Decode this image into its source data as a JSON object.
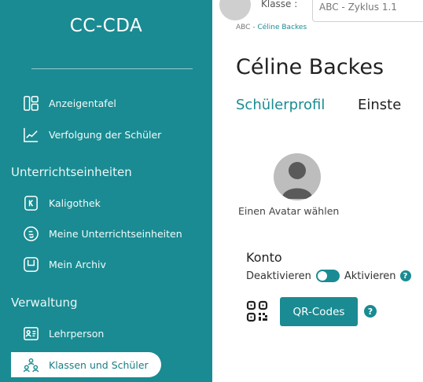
{
  "sidebar": {
    "brand": "CC-CDA",
    "items": [
      {
        "label": "Anzeigentafel",
        "icon": "dashboard-icon"
      },
      {
        "label": "Verfolgung der Schüler",
        "icon": "chart-line-icon"
      }
    ],
    "sections": [
      {
        "label": "Unterrichtseinheiten",
        "items": [
          {
            "label": "Kaligothek",
            "icon": "book-k-icon"
          },
          {
            "label": "Meine Unterrichtseinheiten",
            "icon": "face-icon"
          },
          {
            "label": "Mein Archiv",
            "icon": "archive-icon"
          }
        ]
      },
      {
        "label": "Verwaltung",
        "items": [
          {
            "label": "Lehrperson",
            "icon": "id-card-icon"
          },
          {
            "label": "Klassen und Schüler",
            "icon": "group-icon",
            "active": true
          }
        ]
      }
    ]
  },
  "topbar": {
    "klasse_label": "Klasse :",
    "klasse_value": "ABC - Zyklus 1.1"
  },
  "breadcrumb": {
    "root": "ABC",
    "current": "Céline Backes"
  },
  "page": {
    "title": "Céline Backes",
    "tabs": [
      {
        "label": "Schülerprofil",
        "active": true
      },
      {
        "label": "Einste",
        "active": false
      }
    ],
    "avatar_caption": "Einen Avatar wählen",
    "konto": {
      "title": "Konto",
      "deactivate_label": "Deaktivieren",
      "activate_label": "Aktivieren",
      "toggle_on": true,
      "help": "?"
    },
    "qr": {
      "button_label": "QR-Codes",
      "help": "?"
    }
  },
  "colors": {
    "accent": "#1a8b92",
    "sidebar_bg": "#1a8b92"
  }
}
